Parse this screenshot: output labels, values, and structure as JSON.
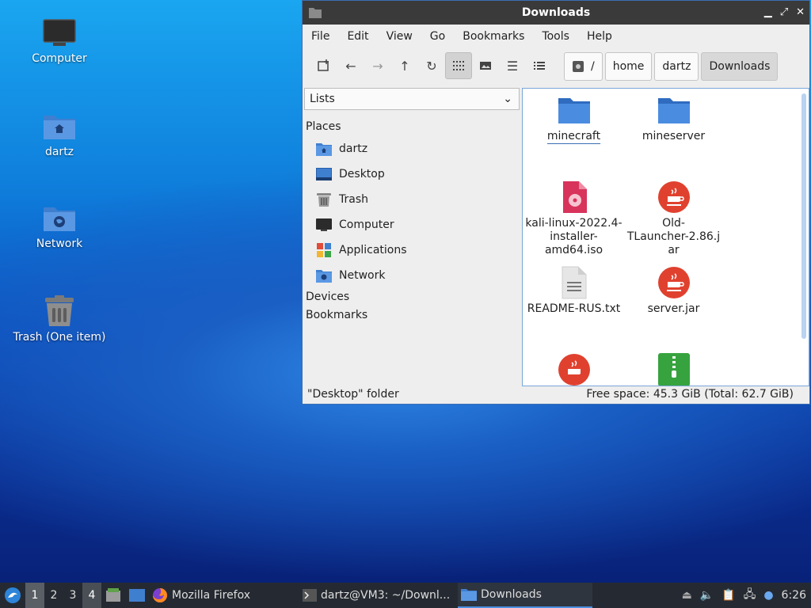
{
  "desktop": {
    "icons": [
      {
        "label": "Computer"
      },
      {
        "label": "dartz"
      },
      {
        "label": "Network"
      },
      {
        "label": "Trash (One item)"
      }
    ]
  },
  "window": {
    "title": "Downloads",
    "controls": {
      "minimize": "▁",
      "maximize": "⤢",
      "close": "✕"
    },
    "menu": [
      "File",
      "Edit",
      "View",
      "Go",
      "Bookmarks",
      "Tools",
      "Help"
    ],
    "breadcrumb": [
      "/",
      "home",
      "dartz",
      "Downloads"
    ],
    "sidebar": {
      "combo_value": "Lists",
      "places_header": "Places",
      "places": [
        "dartz",
        "Desktop",
        "Trash",
        "Computer",
        "Applications",
        "Network"
      ],
      "devices_header": "Devices",
      "bookmarks_header": "Bookmarks"
    },
    "files": [
      {
        "name": "minecraft",
        "type": "folder"
      },
      {
        "name": "mineserver",
        "type": "folder"
      },
      {
        "name": "kali-linux-2022.4-\ninstaller-\namd64.iso",
        "type": "iso"
      },
      {
        "name": "Old-\nTLauncher-2.86.j\nar",
        "type": "java"
      },
      {
        "name": "README-RUS.txt",
        "type": "text"
      },
      {
        "name": "server.jar",
        "type": "java"
      },
      {
        "name": "",
        "type": "java"
      },
      {
        "name": "",
        "type": "archive"
      }
    ],
    "status_left": "\"Desktop\" folder",
    "status_right": "Free space: 45.3 GiB (Total: 62.7 GiB)"
  },
  "taskbar": {
    "workspaces": [
      "1",
      "2",
      "3",
      "4"
    ],
    "tasks": [
      {
        "label": "Mozilla Firefox"
      },
      {
        "label": "dartz@VM3: ~/Downl..."
      },
      {
        "label": "Downloads"
      }
    ],
    "clock": "6:26"
  },
  "colors": {
    "folder": "#3f7fd0",
    "java": "#e0412f",
    "iso": "#d8335b",
    "archive": "#37a33f",
    "accent": "#4a8fe0"
  }
}
